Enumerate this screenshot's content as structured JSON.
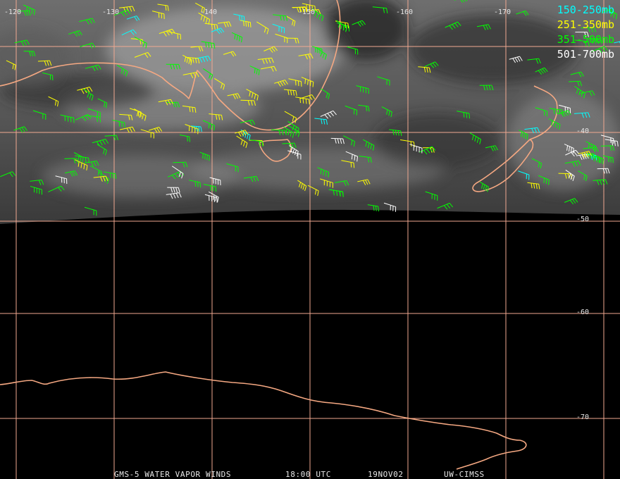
{
  "legend": [
    {
      "label": "150-250mb",
      "color": "#00ffff"
    },
    {
      "label": "251-350mb",
      "color": "#ffff00"
    },
    {
      "label": "351-500mb",
      "color": "#00ff00"
    },
    {
      "label": "501-700mb",
      "color": "#ffffff"
    }
  ],
  "longitude_labels": [
    "-120",
    "-130",
    "-140",
    "-150",
    "-160",
    "-170"
  ],
  "latitude_labels": [
    "-40",
    "-50",
    "-60",
    "-70"
  ],
  "footer": {
    "product": "GMS-5 WATER VAPOR WINDS",
    "time": "18:00 UTC",
    "date": "19NOV02",
    "credit": "UW-CIMSS"
  },
  "colors": {
    "grid": "#f0a890",
    "coastline": "#f5a882",
    "background": "#000000"
  }
}
